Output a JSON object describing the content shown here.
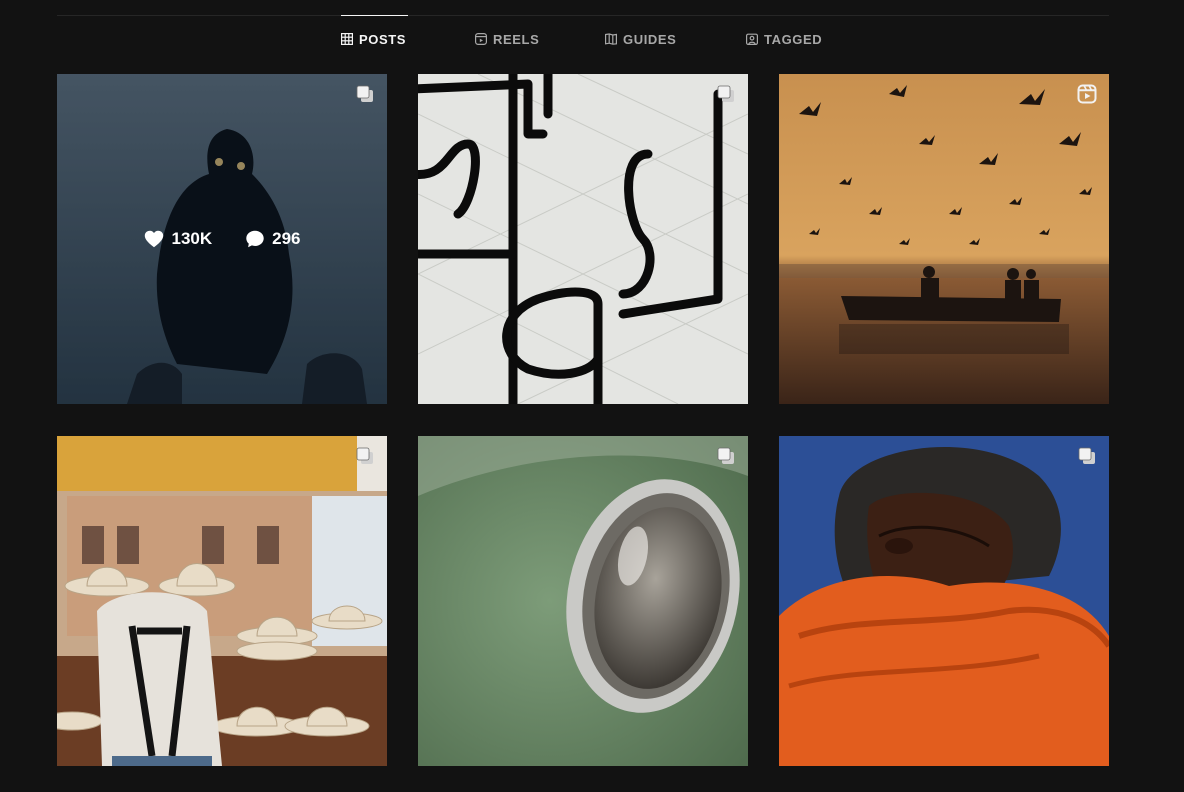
{
  "tabs": [
    {
      "label": "POSTS",
      "icon": "grid-icon",
      "active": true
    },
    {
      "label": "REELS",
      "icon": "reels-icon",
      "active": false
    },
    {
      "label": "GUIDES",
      "icon": "guides-icon",
      "active": false
    },
    {
      "label": "TAGGED",
      "icon": "tagged-icon",
      "active": false
    }
  ],
  "posts": [
    {
      "subject": "reflection",
      "badge": "carousel-icon",
      "hover": {
        "likes": "130K",
        "comments": "296"
      }
    },
    {
      "subject": "abstract-lines",
      "badge": "carousel-icon"
    },
    {
      "subject": "birds-boat-sunset",
      "badge": "reels-icon"
    },
    {
      "subject": "cowboy-hats",
      "badge": "carousel-icon"
    },
    {
      "subject": "car-headlight",
      "badge": "carousel-icon"
    },
    {
      "subject": "orange-sweater-portrait",
      "badge": "carousel-icon"
    }
  ],
  "colors": {
    "background": "#121212",
    "tab_active": "#f5f5f5",
    "tab_inactive": "#a8a8a8"
  }
}
